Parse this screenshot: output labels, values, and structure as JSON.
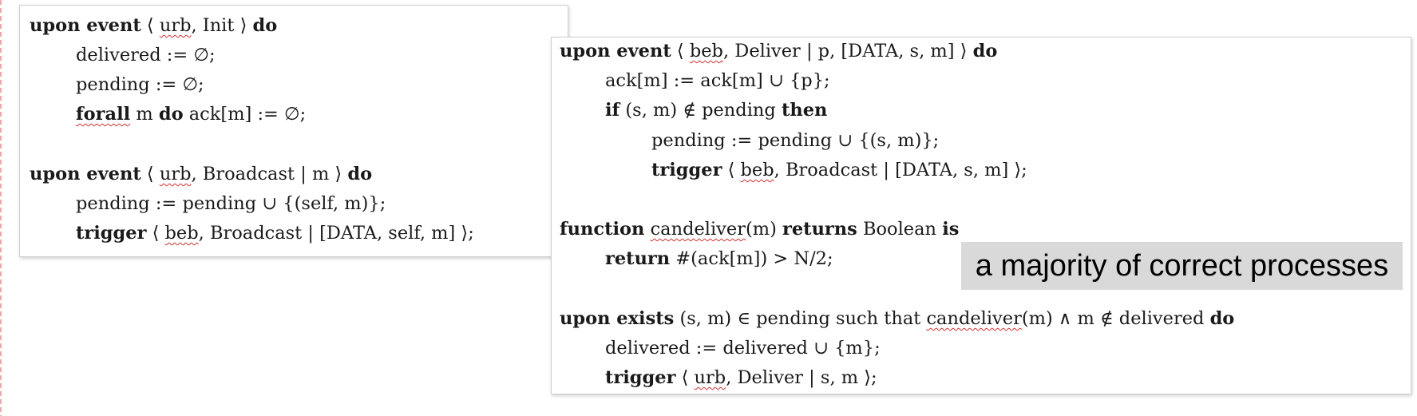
{
  "left_block": {
    "line1": {
      "kw1": "upon event",
      "p1": " ⟨ ",
      "u1": "urb",
      "p2": ", Init ⟩ ",
      "kw2": "do"
    },
    "line2": "delivered := ∅;",
    "line3": "pending := ∅;",
    "line4": {
      "kw1": "forall",
      "p1": " m ",
      "kw2": "do",
      "p2": " ack[m] := ∅;"
    },
    "line5": {
      "kw1": "upon event",
      "p1": " ⟨ ",
      "u1": "urb",
      "p2": ", Broadcast | m ⟩ ",
      "kw2": "do"
    },
    "line6": "pending := pending ∪ {(self, m)};",
    "line7": {
      "kw1": "trigger",
      "p1": " ⟨ ",
      "u1": "beb",
      "p2": ", Broadcast | [DATA, self, m] ⟩;"
    }
  },
  "right_block": {
    "line1": {
      "kw1": "upon event",
      "p1": " ⟨ ",
      "u1": "beb",
      "p2": ", Deliver | p, [DATA, s, m] ⟩ ",
      "kw2": "do"
    },
    "line2": "ack[m] := ack[m] ∪ {p};",
    "line3": {
      "kw1": "if",
      "p1": " (s, m) ∉ pending ",
      "kw2": "then"
    },
    "line4": "pending := pending ∪ {(s, m)};",
    "line5": {
      "kw1": "trigger",
      "p1": " ⟨ ",
      "u1": "beb",
      "p2": ", Broadcast | [DATA, s, m] ⟩;"
    },
    "line6": {
      "kw1": "function",
      "p1": " ",
      "u1": "candeliver",
      "p2": "(m) ",
      "kw2": "returns",
      "p3": " Boolean ",
      "kw3": "is"
    },
    "line7": {
      "kw1": "return",
      "p1": " #(ack[m]) > N/2;"
    },
    "line8": {
      "kw1": "upon exists",
      "p1": " (s, m) ∈ pending such that ",
      "u1": "candeliver",
      "p2": "(m) ∧ m ∉ delivered ",
      "kw2": "do"
    },
    "line9": "delivered := delivered ∪ {m};",
    "line10": {
      "kw1": "trigger",
      "p1": " ⟨ ",
      "u1": "urb",
      "p2": ", Deliver | s, m ⟩;"
    }
  },
  "callout": {
    "text": "a majority of correct processes"
  }
}
